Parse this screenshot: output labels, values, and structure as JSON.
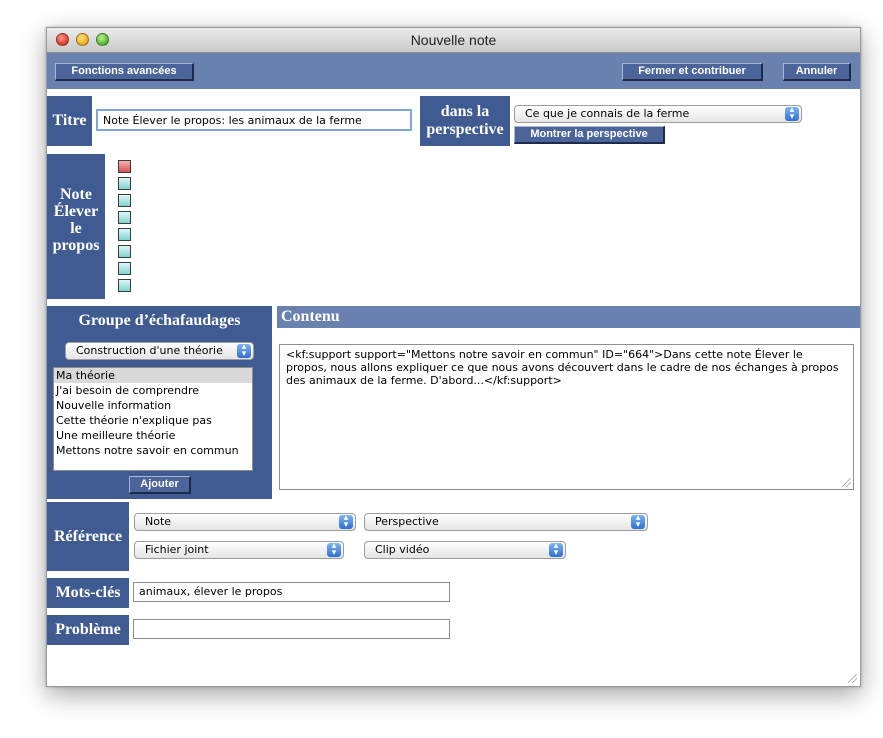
{
  "window": {
    "title": "Nouvelle note"
  },
  "toolbar": {
    "advanced_label": "Fonctions avancées",
    "close_contribute_label": "Fermer et contribuer",
    "cancel_label": "Annuler"
  },
  "titre": {
    "label": "Titre",
    "value": "Note Élever le propos: les animaux de la ferme"
  },
  "perspective": {
    "label_line1": "dans la",
    "label_line2": "perspective",
    "selected": "Ce que je connais de la ferme",
    "show_button_label": "Montrer la perspective"
  },
  "note_block": {
    "line1": "Note",
    "line2": "Élever",
    "line3": "le",
    "line4": "propos"
  },
  "scaffold": {
    "header": "Groupe d’échafaudages",
    "selected_group": "Construction d'une théorie",
    "items": [
      "Ma théorie",
      "J'ai besoin de comprendre",
      "Nouvelle information",
      "Cette théorie n'explique pas",
      "Une meilleure théorie",
      "Mettons notre savoir en commun"
    ],
    "add_label": "Ajouter"
  },
  "content": {
    "header": "Contenu",
    "text": "<kf:support support=\"Mettons notre savoir en commun\" ID=\"664\">Dans cette note Élever le propos, nous allons expliquer ce que nous avons découvert dans le cadre de nos échanges à propos des animaux de la ferme. D'abord...</kf:support>"
  },
  "reference": {
    "label": "Référence",
    "note_select": "Note",
    "perspective_select": "Perspective",
    "attachment_select": "Fichier joint",
    "video_select": "Clip vidéo"
  },
  "keywords": {
    "label": "Mots-clés",
    "value": "animaux, élever le propos"
  },
  "problem": {
    "label": "Problème",
    "value": ""
  },
  "colors": {
    "panel_blue": "#3f5b92",
    "toolbar_blue": "#6981af",
    "header_blue": "#6981af"
  }
}
